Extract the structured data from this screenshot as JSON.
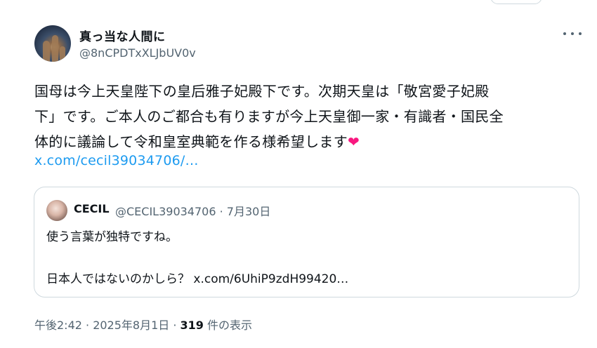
{
  "tweet": {
    "display_name": "真っ当な人間に",
    "handle": "@8nCPDTxXLJbUV0v",
    "text_lines": [
      "国母は今上天皇陛下の皇后雅子妃殿下です。次期天皇は「敬宮愛子妃殿",
      "下」です。ご本人のご都合も有りますが今上天皇御一家・有識者・国民全",
      "体的に議論して令和皇室典範を作る様希望します"
    ],
    "heart_emoji": "❤",
    "link": "x.com/cecil39034706/…",
    "timestamp": "午後2:42 · 2025年8月1日 · ",
    "views_count": "319",
    "views_label": " 件の表示"
  },
  "quote": {
    "name": "CECIL",
    "handle_date": "@CECIL39034706 · 7月30日",
    "line1": "使う言葉が独特ですね。",
    "line2": "日本人ではないのかしら？ x.com/6UhiP9zdH99420…"
  },
  "icons": {
    "more": "more-icon",
    "heart": "heart-icon"
  },
  "colors": {
    "link": "#1d9bf0",
    "secondary_text": "#536471",
    "border": "#cfd9de",
    "heart": "#f91880"
  }
}
